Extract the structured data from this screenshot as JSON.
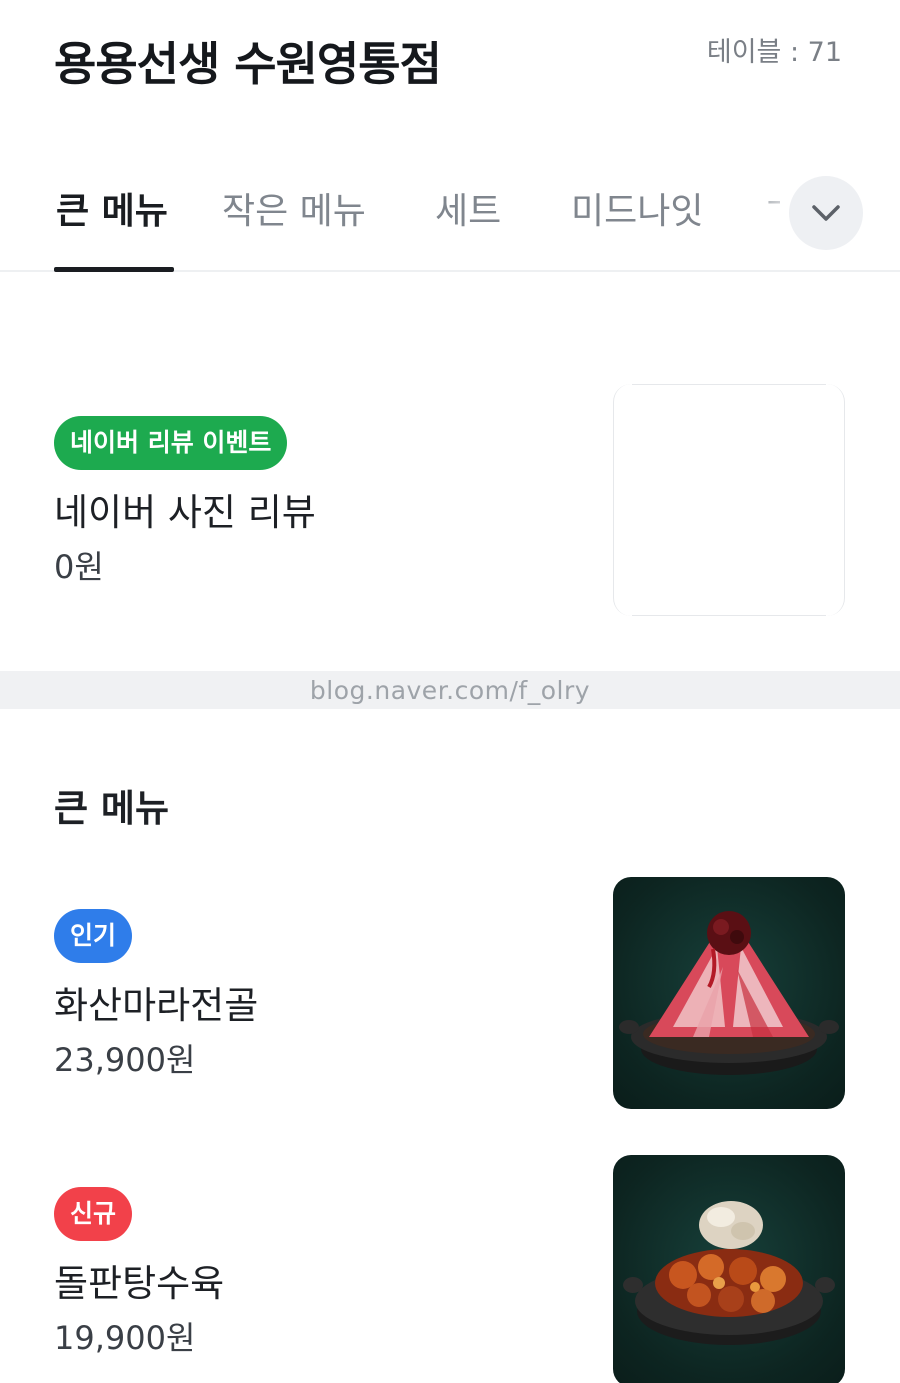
{
  "header": {
    "store_name": "용용선생 수원영통점",
    "table_label": "테이블 : 71"
  },
  "tabs": [
    {
      "label": "큰 메뉴",
      "active": true
    },
    {
      "label": "작은 메뉴",
      "active": false
    },
    {
      "label": "세트",
      "active": false
    },
    {
      "label": "미드나잇",
      "active": false
    },
    {
      "label": "ㄱ",
      "active": false
    }
  ],
  "dropdown_icon": "chevron-down-icon",
  "event_item": {
    "badge": "네이버 리뷰 이벤트",
    "name": "네이버 사진 리뷰",
    "price": "0원"
  },
  "watermark": "blog.naver.com/f_olry",
  "section": {
    "title": "큰 메뉴"
  },
  "menu_items": [
    {
      "badge": "인기",
      "badge_color": "#2f7dea",
      "name": "화산마라전골",
      "price": "23,900원",
      "image": "volcano-mala-hotpot-image"
    },
    {
      "badge": "신규",
      "badge_color": "#f2414a",
      "name": "돌판탕수육",
      "price": "19,900원",
      "image": "stone-plate-sweet-sour-pork-image"
    }
  ],
  "colors": {
    "green_badge": "#1daa4f",
    "blue_badge": "#2f7dea",
    "red_badge": "#f2414a",
    "image_background": "#0f2a26"
  }
}
